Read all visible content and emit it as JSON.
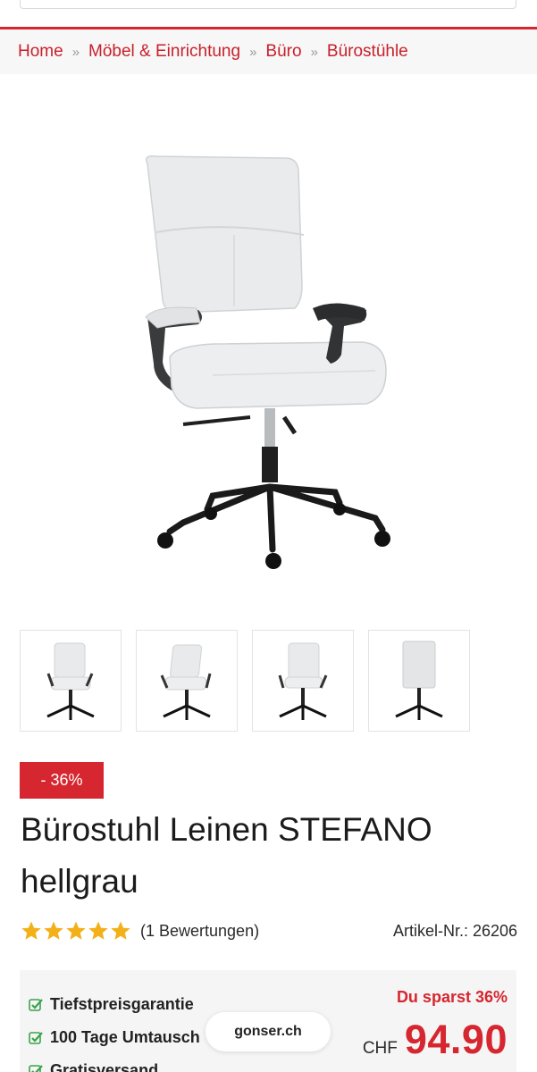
{
  "breadcrumb": {
    "items": [
      "Home",
      "Möbel & Einrichtung",
      "Büro",
      "Bürostühle"
    ],
    "separator": "»"
  },
  "product": {
    "discount_badge": "- 36%",
    "title_line1": "Bürostuhl Leinen STEFANO",
    "title_line2": "hellgrau",
    "rating_stars": 5,
    "rating_count": "(1 Bewertungen)",
    "article_number": "Artikel-Nr.: 26206",
    "thumbnail_count": 4
  },
  "benefits": [
    "Tiefstpreisgarantie",
    "100 Tage Umtausch",
    "Gratisversand"
  ],
  "pricing": {
    "savings": "Du sparst 36%",
    "currency": "CHF",
    "price": "94.90"
  },
  "browser": {
    "url": "gonser.ch"
  },
  "colors": {
    "brand_red": "#d6262f",
    "star_gold": "#f3b019",
    "check_green": "#3aa34a"
  }
}
